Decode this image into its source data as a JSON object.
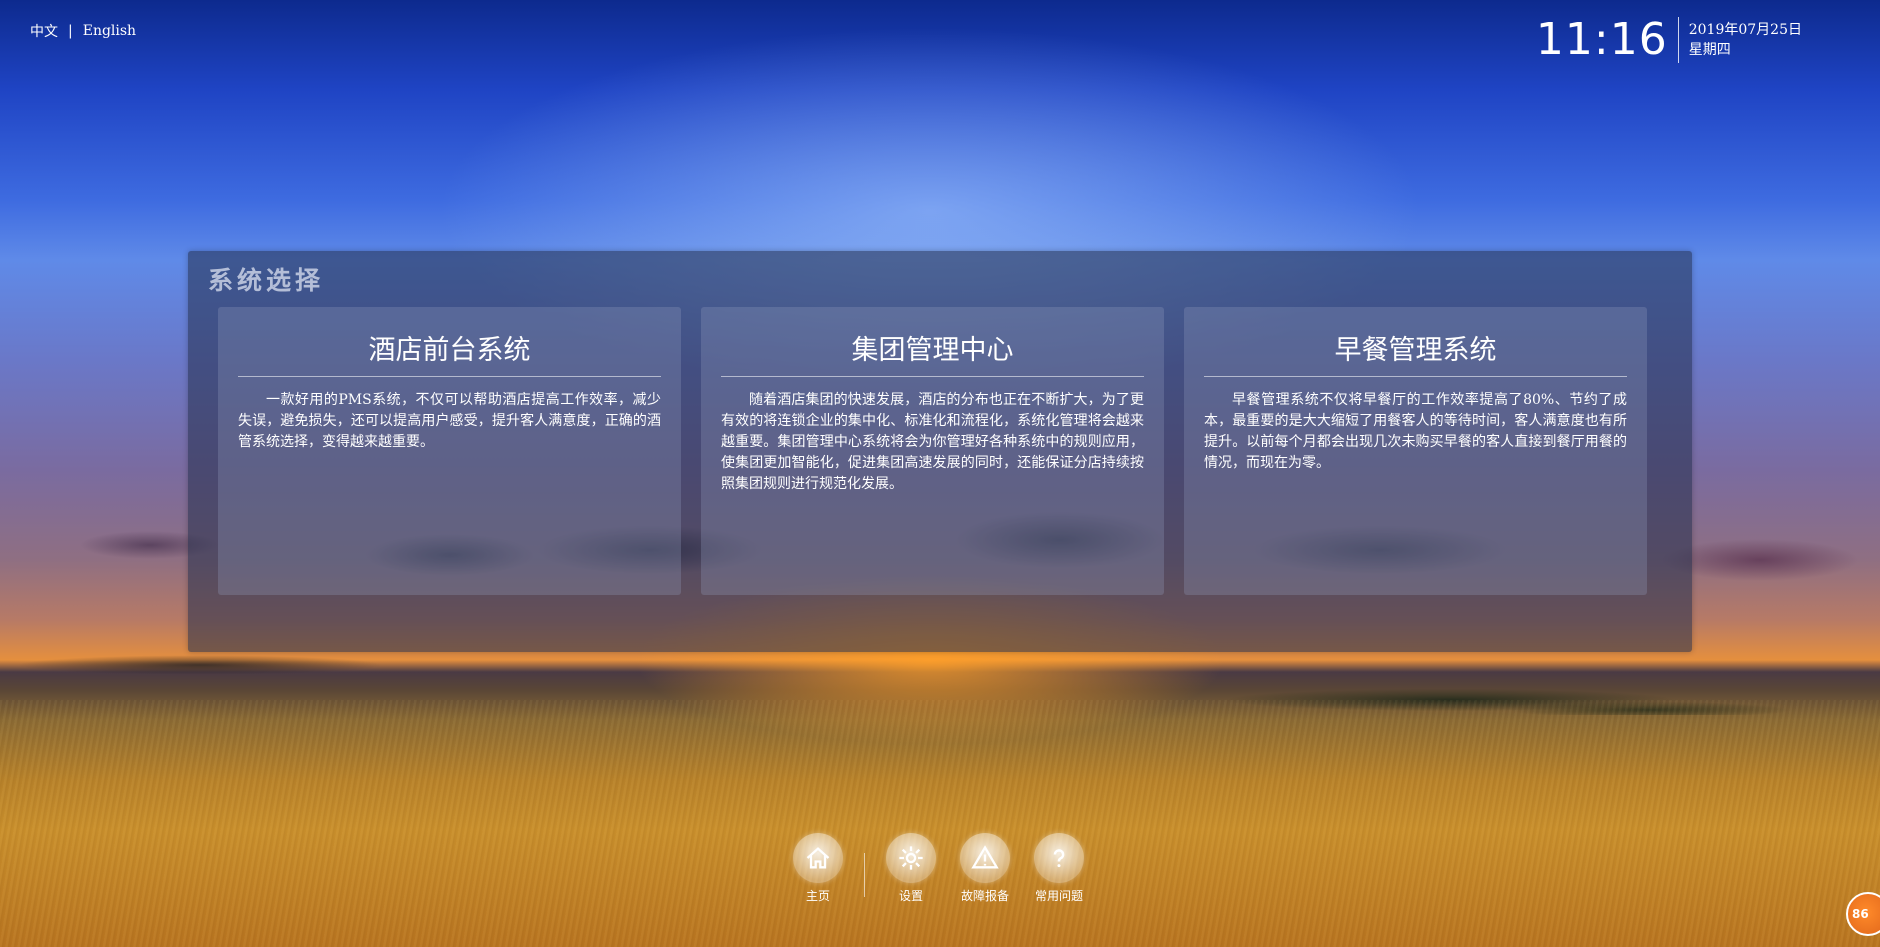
{
  "language": {
    "chinese": "中文",
    "separator": "|",
    "english": "English"
  },
  "clock": {
    "time": "11:16",
    "date": "2019年07月25日",
    "weekday": "星期四"
  },
  "panel": {
    "title": "系统选择",
    "cards": [
      {
        "title": "酒店前台系统",
        "description": "一款好用的PMS系统，不仅可以帮助酒店提高工作效率，减少失误，避免损失，还可以提高用户感受，提升客人满意度，正确的酒管系统选择，变得越来越重要。"
      },
      {
        "title": "集团管理中心",
        "description": "随着酒店集团的快速发展，酒店的分布也正在不断扩大，为了更有效的将连锁企业的集中化、标准化和流程化，系统化管理将会越来越重要。集团管理中心系统将会为你管理好各种系统中的规则应用，使集团更加智能化，促进集团高速发展的同时，还能保证分店持续按照集团规则进行规范化发展。"
      },
      {
        "title": "早餐管理系统",
        "description": "早餐管理系统不仅将早餐厅的工作效率提高了80%、节约了成本，最重要的是大大缩短了用餐客人的等待时间，客人满意度也有所提升。以前每个月都会出现几次未购买早餐的客人直接到餐厅用餐的情况，而现在为零。"
      }
    ]
  },
  "nav": {
    "home": "主页",
    "settings": "设置",
    "report": "故障报备",
    "faq": "常用问题"
  },
  "badge": "86",
  "colors": {
    "panel_bg": "#232d4b",
    "badge": "#f07a22"
  },
  "icons": {
    "home": "home-icon",
    "settings": "gear-icon",
    "report": "warning-icon",
    "faq": "question-icon"
  }
}
